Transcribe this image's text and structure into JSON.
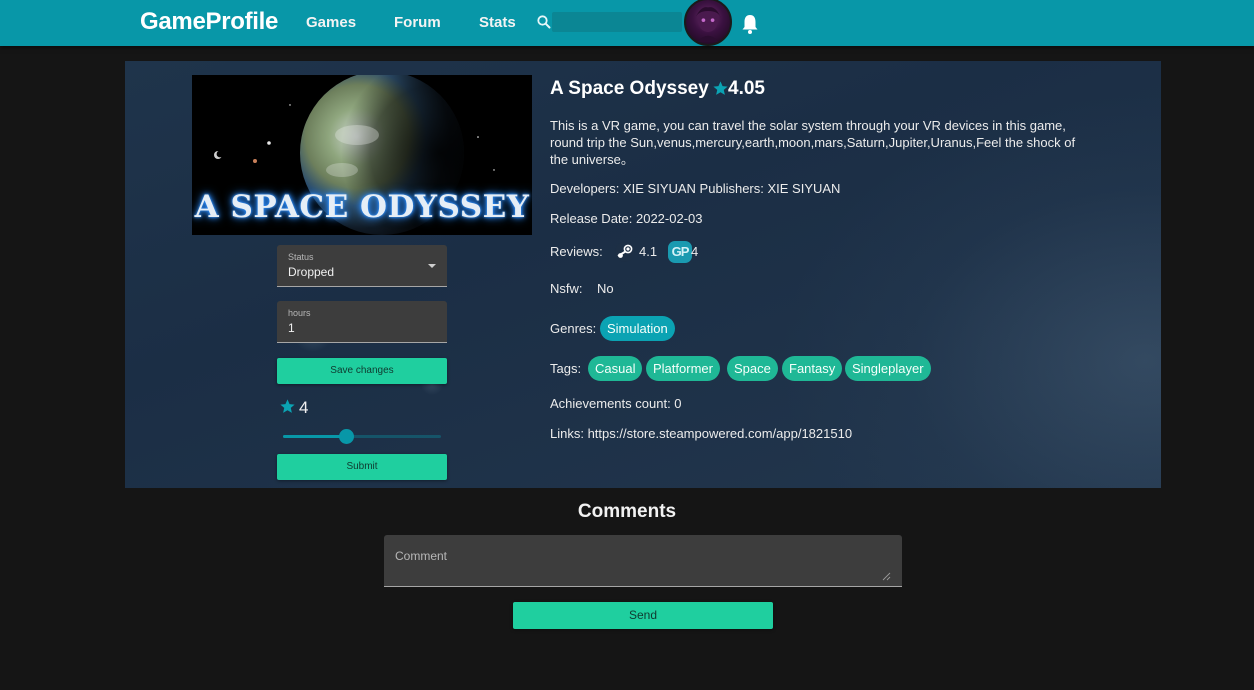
{
  "header": {
    "brand": "GameProfile",
    "nav": [
      "Games",
      "Forum",
      "Stats"
    ],
    "search_placeholder": "",
    "colors": {
      "bar": "#0897a8",
      "accent": "#1fcf9f"
    }
  },
  "game": {
    "cover_title": "A SPACE ODYSSEY",
    "title": "A Space Odyssey",
    "rating": "4.05",
    "description": "This is a VR game, you can travel the solar system through your VR devices in this game, round trip the Sun,venus,mercury,earth,moon,mars,Saturn,Jupiter,Uranus,Feel the shock of the universe。",
    "developers_line": "Developers: XIE SIYUAN Publishers: XIE SIYUAN",
    "release_line": "Release Date: 2022-02-03",
    "reviews_label": "Reviews:",
    "steam_score": "4.1",
    "gp_icon_text": "GP",
    "gp_score": "4",
    "nsfw_label": "Nsfw:",
    "nsfw_value": "No",
    "genres_label": "Genres:",
    "genres": [
      "Simulation"
    ],
    "tags_label": "Tags:",
    "tags": [
      "Casual",
      "Platformer",
      "Space",
      "Fantasy",
      "Singleplayer"
    ],
    "achievements_line": "Achievements count: 0",
    "links_line": "Links: https://store.steampowered.com/app/1821510"
  },
  "user_panel": {
    "status_label": "Status",
    "status_value": "Dropped",
    "hours_label": "hours",
    "hours_value": "1",
    "save_label": "Save changes",
    "user_rating": "4",
    "slider_fraction": 0.4,
    "submit_label": "Submit"
  },
  "comments": {
    "heading": "Comments",
    "placeholder": "Comment",
    "send_label": "Send"
  }
}
